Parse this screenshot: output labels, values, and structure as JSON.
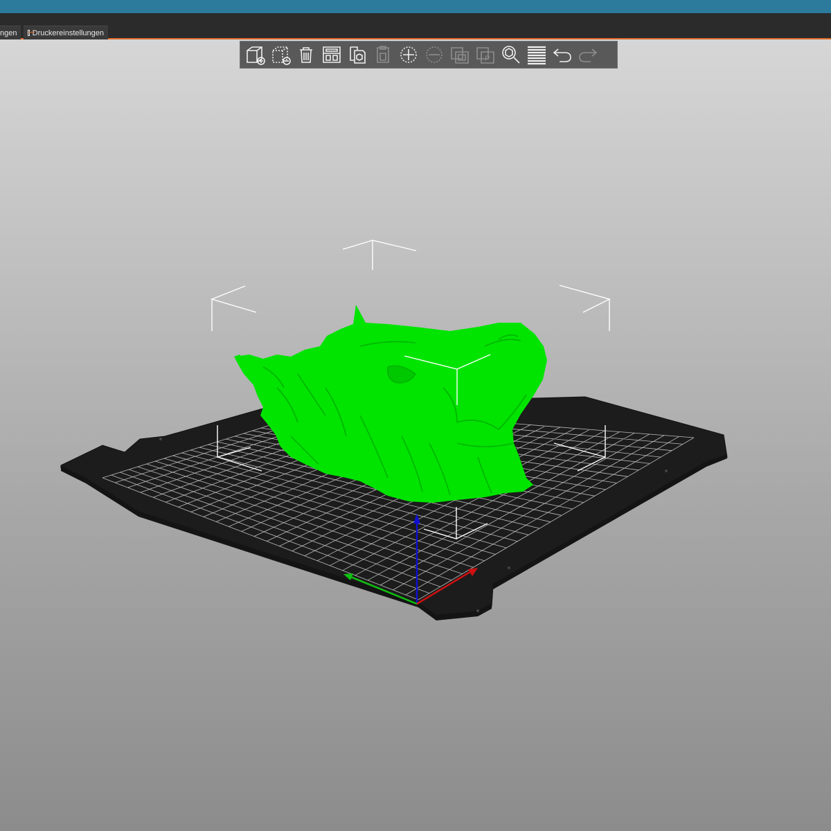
{
  "window": {
    "accent_color": "#2c7a9c",
    "tab_underline_color": "#e06a2b"
  },
  "tabs": [
    {
      "label": "ngen",
      "state": "partially visible"
    },
    {
      "label": "Druckereinstellungen",
      "icon": "printer-settings-icon"
    }
  ],
  "toolbar": {
    "buttons": [
      {
        "name": "add-object-button",
        "icon": "add-cube-icon",
        "enabled": true
      },
      {
        "name": "delete-object-button",
        "icon": "remove-cube-icon",
        "enabled": true
      },
      {
        "name": "delete-all-button",
        "icon": "trash-icon",
        "enabled": true
      },
      {
        "name": "arrange-button",
        "icon": "arrange-icon",
        "enabled": true
      },
      {
        "name": "copy-button",
        "icon": "copy-icon",
        "enabled": true
      },
      {
        "name": "paste-button",
        "icon": "paste-icon",
        "enabled": false
      },
      {
        "name": "add-instance-button",
        "icon": "plus-circle-icon",
        "enabled": true
      },
      {
        "name": "remove-instance-button",
        "icon": "minus-circle-icon",
        "enabled": false
      },
      {
        "name": "split-objects-button",
        "icon": "split-objects-icon",
        "enabled": false
      },
      {
        "name": "split-parts-button",
        "icon": "split-parts-icon",
        "enabled": false
      },
      {
        "name": "search-button",
        "icon": "search-icon",
        "enabled": true
      },
      {
        "name": "layer-editing-button",
        "icon": "layers-icon",
        "enabled": true
      },
      {
        "name": "undo-button",
        "icon": "undo-icon",
        "enabled": true
      },
      {
        "name": "redo-button",
        "icon": "redo-icon",
        "enabled": false
      }
    ]
  },
  "scene": {
    "model_color": "#00e000",
    "bed_color": "#1c1c1c",
    "grid_color": "#e8e8e8",
    "axis_colors": {
      "x": "#d01010",
      "y": "#10c010",
      "z": "#1010d0"
    }
  }
}
